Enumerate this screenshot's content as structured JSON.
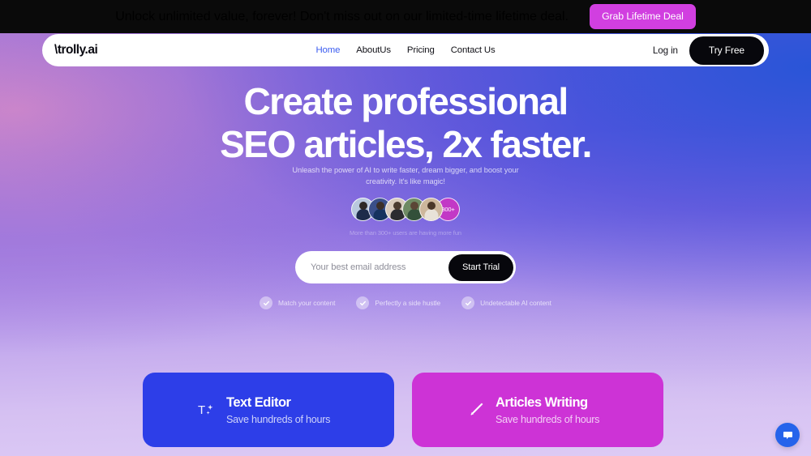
{
  "announcement": {
    "text": "Unlock unlimited value, forever! Don't miss out on our limited-time lifetime deal.",
    "cta_label": "Grab Lifetime Deal",
    "cta_color": "#d13fe0",
    "bar_color": "#0a0a0a"
  },
  "nav": {
    "logo_slash": "\\",
    "logo_text": "trolly.ai",
    "links": [
      {
        "label": "Home",
        "active": true
      },
      {
        "label": "AboutUs",
        "active": false
      },
      {
        "label": "Pricing",
        "active": false
      },
      {
        "label": "Contact Us",
        "active": false
      }
    ],
    "active_link_color": "#3b5cf0",
    "login_label": "Log in",
    "try_free_label": "Try Free"
  },
  "hero": {
    "headline_line1": "Create professional",
    "headline_line2": "SEO articles, 2x faster.",
    "subheadline": "Unleash the power of AI to write faster, dream bigger, and boost your creativity. It's like magic!",
    "social_caption": "More than 300+ users are having more fun",
    "avatar_count_label": "300+",
    "avatar_count_color": "#c238c6",
    "avatars": [
      {
        "name": "avatar-1",
        "bg": "#b9c9dd",
        "head": "#2f2a27",
        "body": "#1d2b4a"
      },
      {
        "name": "avatar-2",
        "bg": "#3a4f8a",
        "head": "#3b2f2a",
        "body": "#16325f"
      },
      {
        "name": "avatar-3",
        "bg": "#d8cbbd",
        "head": "#4a3b30",
        "body": "#2b2b2f"
      },
      {
        "name": "avatar-4",
        "bg": "#6e8a63",
        "head": "#5b4636",
        "body": "#33503a"
      },
      {
        "name": "avatar-5",
        "bg": "#cdb79c",
        "head": "#4b3728",
        "body": "#e8e2d8"
      }
    ]
  },
  "signup": {
    "email_placeholder": "Your best email address",
    "email_value": "",
    "submit_label": "Start Trial"
  },
  "feature_checks": [
    {
      "label": "Match your content"
    },
    {
      "label": "Perfectly a side hustle"
    },
    {
      "label": "Undetectable AI content"
    }
  ],
  "feature_cards": [
    {
      "title": "Text Editor",
      "subtitle": "Save hundreds of hours",
      "icon": "text-sparkle-icon",
      "color": "#2d3ee8"
    },
    {
      "title": "Articles Writing",
      "subtitle": "Save hundreds of hours",
      "icon": "pencil-icon",
      "color": "#cd33d6"
    }
  ],
  "chat_widget": {
    "icon": "chat-bubble-icon",
    "color": "#2563eb"
  }
}
